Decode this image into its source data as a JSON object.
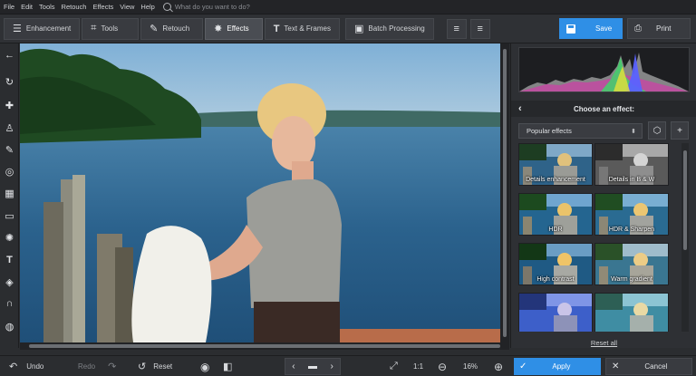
{
  "menu": {
    "items": [
      "File",
      "Edit",
      "Tools",
      "Retouch",
      "Effects",
      "View",
      "Help"
    ],
    "search_placeholder": "What do you want to do?"
  },
  "toolbar": {
    "tabs": [
      {
        "label": "Enhancement",
        "icon": "sliders-icon"
      },
      {
        "label": "Tools",
        "icon": "crop-icon"
      },
      {
        "label": "Retouch",
        "icon": "brush-icon"
      },
      {
        "label": "Effects",
        "icon": "magic-wand-icon",
        "active": true
      },
      {
        "label": "Text & Frames",
        "icon": "text-icon"
      },
      {
        "label": "Batch Processing",
        "icon": "batch-icon"
      }
    ],
    "save_label": "Save",
    "print_label": "Print"
  },
  "effects_panel": {
    "header": "Choose an effect:",
    "dropdown_value": "Popular effects",
    "effects": [
      {
        "label": "Details enhancement"
      },
      {
        "label": "Details in B & W"
      },
      {
        "label": "HDR"
      },
      {
        "label": "HDR & Sharpen"
      },
      {
        "label": "High contrast"
      },
      {
        "label": "Warm gradient"
      },
      {
        "label": ""
      },
      {
        "label": ""
      }
    ],
    "reset_all": "Reset all"
  },
  "bottom": {
    "undo": "Undo",
    "redo": "Redo",
    "reset": "Reset",
    "ratio": "1:1",
    "zoom": "16%",
    "apply": "Apply",
    "cancel": "Cancel"
  },
  "colors": {
    "accent": "#2f8fe6",
    "background": "#2b2d30"
  }
}
